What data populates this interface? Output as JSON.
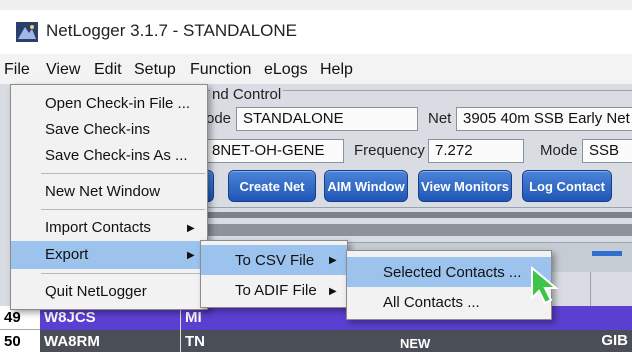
{
  "window": {
    "title": "NetLogger 3.1.7 - STANDALONE"
  },
  "menubar": {
    "items": [
      "File",
      "View",
      "Edit",
      "Setup",
      "Function",
      "eLogs",
      "Help"
    ]
  },
  "net_control": {
    "group_title": "nd Control",
    "mode_label": "ode",
    "mode_value": "STANDALONE",
    "net_label": "Net",
    "net_value": "3905 40m SSB Early Net",
    "logger_value": "8NET-OH-GENE",
    "frequency_label": "Frequency",
    "frequency_value": "7.272",
    "band_mode_label": "Mode",
    "band_mode_value": "SSB"
  },
  "toolbar": {
    "create_net": "Create Net",
    "aim_window": "AIM Window",
    "view_monitors": "View Monitors",
    "log_contact": "Log Contact"
  },
  "file_menu": {
    "open_checkin": "Open Check-in File ...",
    "save_checkins": "Save Check-ins",
    "save_checkins_as": "Save Check-ins As ...",
    "new_net_window": "New Net Window",
    "import_contacts": "Import Contacts",
    "export": "Export",
    "quit": "Quit NetLogger"
  },
  "export_menu": {
    "to_csv": "To CSV File",
    "to_adif": "To ADIF File"
  },
  "csv_menu": {
    "selected_contacts": "Selected Contacts ...",
    "all_contacts": "All Contacts ..."
  },
  "rows": [
    {
      "num": "49",
      "call": "W8JCS",
      "state": "MI",
      "tag": "",
      "note": "",
      "color": "#5b3fd0"
    },
    {
      "num": "50",
      "call": "WA8RM",
      "state": "TN",
      "tag": "GIB",
      "note": "NEW",
      "color": "#4a4f57"
    }
  ],
  "colors": {
    "menu_highlight": "#9cc3ee",
    "button_blue": "#2a63c4",
    "row_purple": "#5b3fd0",
    "cursor_green": "#3fc44a"
  }
}
